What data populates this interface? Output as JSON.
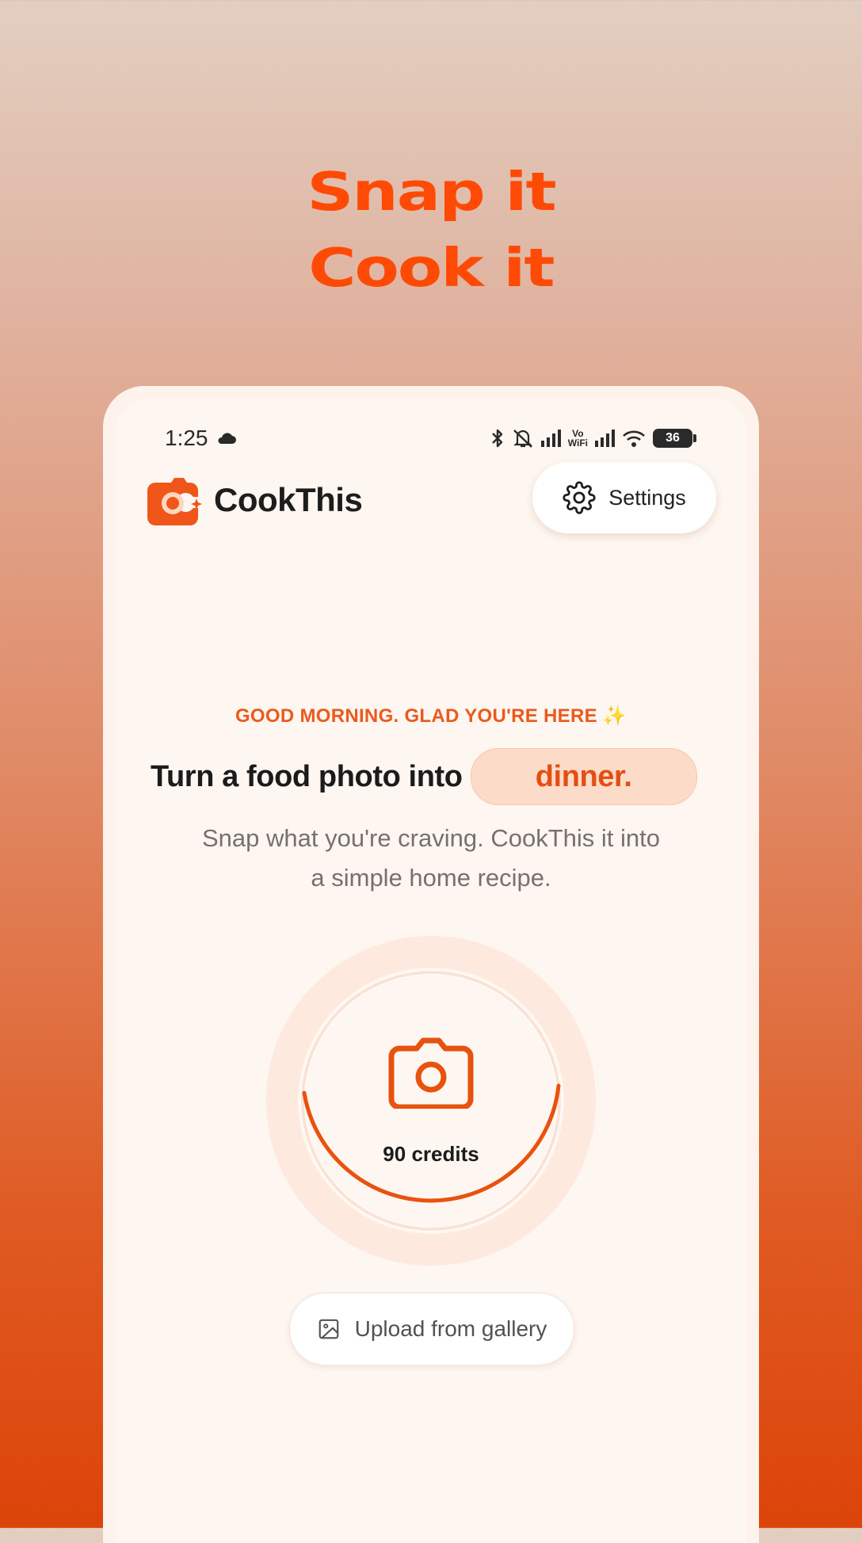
{
  "promo": {
    "line1": "Snap it",
    "line2": "Cook it"
  },
  "status_bar": {
    "time": "1:25",
    "cloud_icon": "cloud-icon",
    "vowifi_top": "Vo",
    "vowifi_bottom": "WiFi",
    "battery": "36"
  },
  "header": {
    "app_name": "CookThis",
    "settings_label": "Settings",
    "settings_icon": "gear-icon"
  },
  "hero": {
    "greeting": "GOOD MORNING. GLAD YOU'RE HERE ✨",
    "headline_prefix": "Turn a food photo into",
    "headline_highlight": "dinner.",
    "subtitle": "Snap what you're craving. CookThis it into a simple home recipe."
  },
  "capture": {
    "camera_icon": "camera-icon",
    "credits_label": "90 credits"
  },
  "upload": {
    "label": "Upload from gallery",
    "icon": "image-icon"
  },
  "colors": {
    "accent": "#e8520f",
    "accent_light": "#fddbc9",
    "background": "#fef6f0",
    "promo_title": "#ff4a05"
  }
}
